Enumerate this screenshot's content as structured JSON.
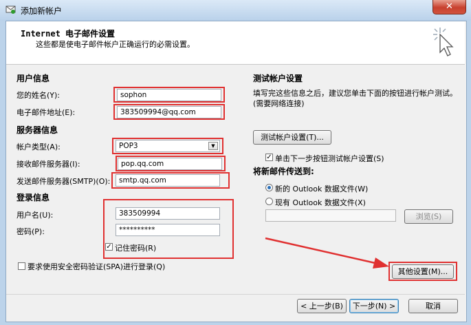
{
  "window": {
    "title": "添加新帐户",
    "close_glyph": "✕"
  },
  "header": {
    "title": "Internet 电子邮件设置",
    "subtitle": "这些都是使电子邮件帐户正确运行的必需设置。"
  },
  "user_info": {
    "section": "用户信息",
    "name_label": "您的姓名(Y):",
    "name_value": "sophon",
    "email_label": "电子邮件地址(E):",
    "email_value": "383509994@qq.com"
  },
  "server_info": {
    "section": "服务器信息",
    "account_type_label": "帐户类型(A):",
    "account_type_value": "POP3",
    "incoming_label": "接收邮件服务器(I):",
    "incoming_value": "pop.qq.com",
    "outgoing_label": "发送邮件服务器(SMTP)(O):",
    "outgoing_value": "smtp.qq.com"
  },
  "login_info": {
    "section": "登录信息",
    "username_label": "用户名(U):",
    "username_value": "383509994",
    "password_label": "密码(P):",
    "password_value": "**********",
    "remember_label": "记住密码(R)",
    "remember_checked": true,
    "spa_label": "要求使用安全密码验证(SPA)进行登录(Q)",
    "spa_checked": false
  },
  "test": {
    "section": "测试帐户设置",
    "description": "填写完这些信息之后，建议您单击下面的按钮进行帐户测试。(需要网络连接)",
    "test_button": "测试帐户设置(T)...",
    "auto_test_label": "单击下一步按钮测试帐户设置(S)",
    "auto_test_checked": true
  },
  "delivery": {
    "section": "将新邮件传送到:",
    "option_new": "新的 Outlook 数据文件(W)",
    "option_existing": "现有 Outlook 数据文件(X)",
    "selected": "new",
    "browse_button": "浏览(S)"
  },
  "buttons": {
    "more_settings": "其他设置(M)...",
    "back": "< 上一步(B)",
    "next": "下一步(N) >",
    "cancel": "取消"
  },
  "colors": {
    "highlight": "#e03030",
    "accent": "#2a6fb8"
  },
  "icons": {
    "title": "mail-account-icon",
    "wizard": "cursor-sparkle-icon",
    "dropdown": "chevron-down-icon",
    "check": "check-icon"
  }
}
